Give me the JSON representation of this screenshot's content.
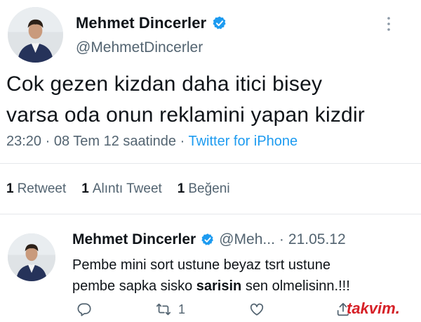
{
  "main_tweet": {
    "name": "Mehmet Dincerler",
    "handle": "@MehmetDincerler",
    "text_line1": "Cok gezen kizdan daha itici bisey",
    "text_line2": "varsa oda onun reklamini yapan kizdir",
    "timestamp": "23:20 · 08 Tem 12 saatinde ·",
    "source": "Twitter for iPhone",
    "stats": [
      {
        "count": "1",
        "label": "Retweet"
      },
      {
        "count": "1",
        "label": "Alıntı Tweet"
      },
      {
        "count": "1",
        "label": "Beğeni"
      }
    ]
  },
  "reply_tweet": {
    "name": "Mehmet Dincerler",
    "handle": "@Meh...",
    "separator": "·",
    "date": "21.05.12",
    "text_line1": "Pembe mini sort ustune beyaz tsrt ustune",
    "text_line2_part1": "pembe sapka sisko",
    "text_line2_bold": "sarisin",
    "text_line2_part2": "sen olmelisinn.!!!",
    "retweet_count": "1"
  },
  "icons": {
    "verified": "verified-badge-icon",
    "more": "more-vertical-icon",
    "reply": "reply-icon",
    "retweet": "retweet-icon",
    "like": "heart-icon",
    "share": "share-icon"
  },
  "colors": {
    "verified": "#1d9bf0",
    "link": "#1d9bf0",
    "muted": "#536471",
    "watermark": "#d62027"
  },
  "watermark": "takvim"
}
